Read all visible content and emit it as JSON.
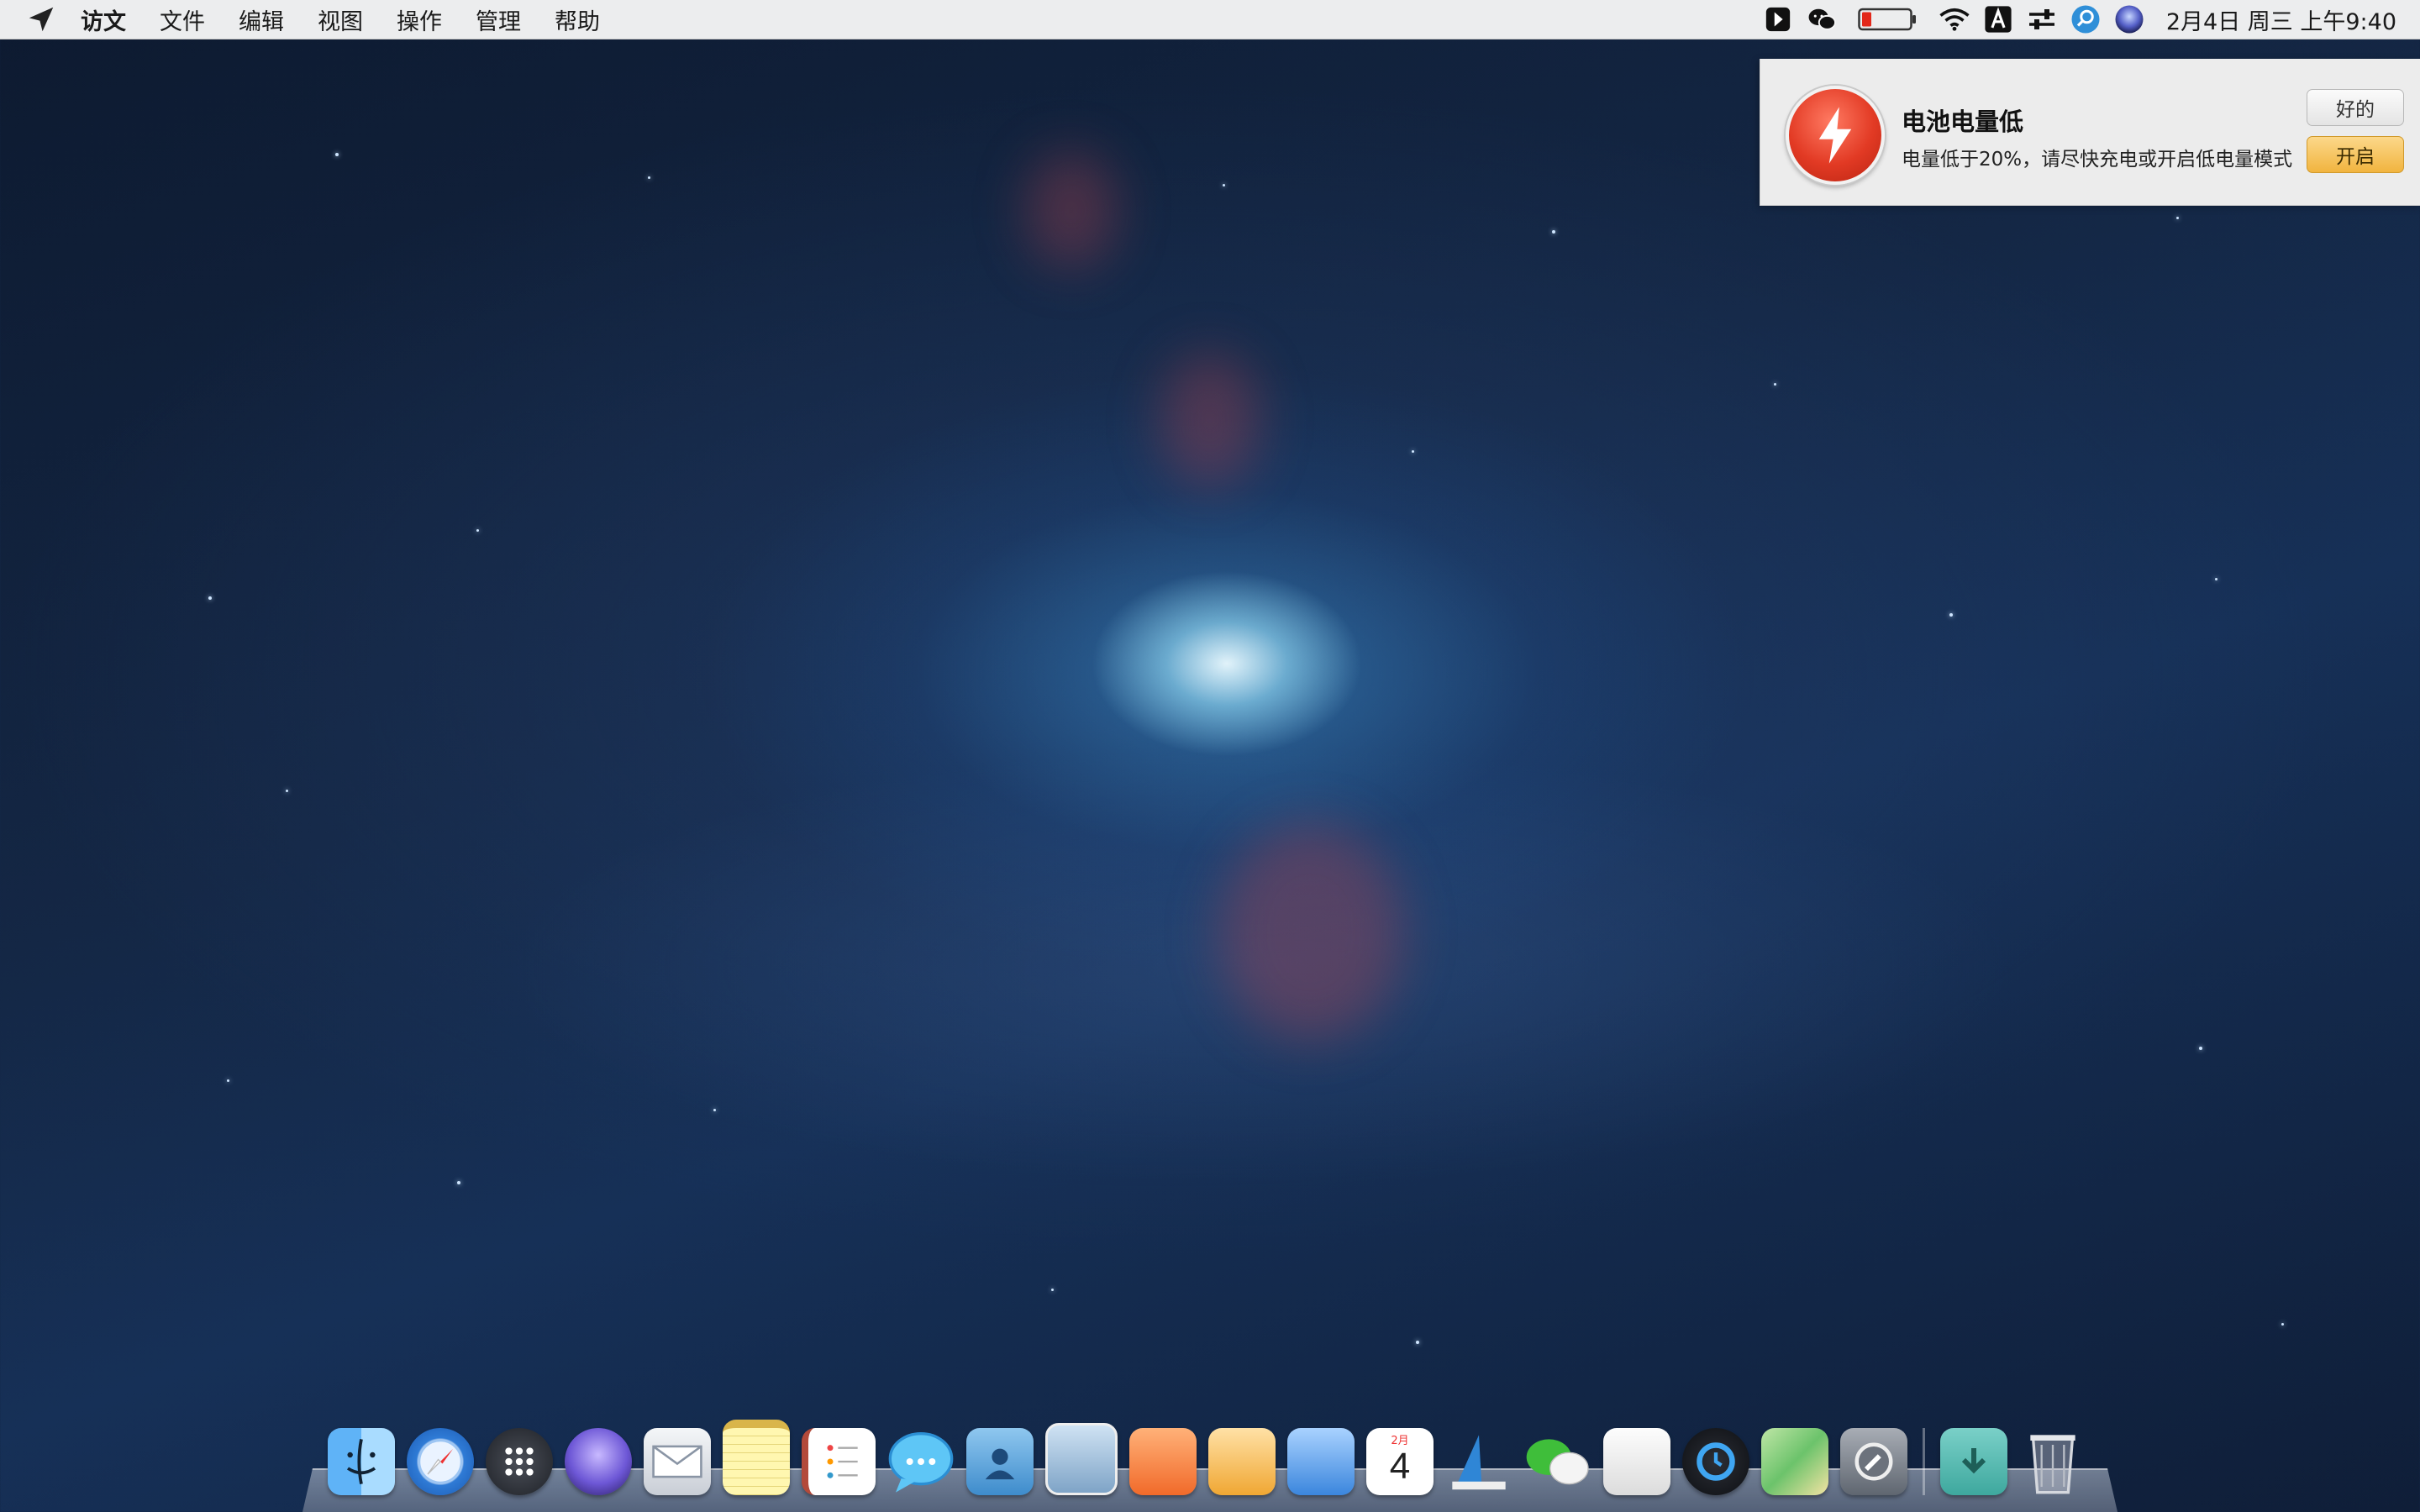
{
  "menubar": {
    "app_name": "访文",
    "menus": [
      "文件",
      "编辑",
      "视图",
      "操作",
      "管理",
      "帮助"
    ],
    "status_icons": [
      "sketch-icon",
      "wechat-icon",
      "battery-icon",
      "wifi-icon",
      "input-method-icon",
      "controls-icon",
      "spotlight-icon",
      "siri-icon"
    ],
    "battery_level": 0.2,
    "clock": "2月4日 周三 上午9:40"
  },
  "notification": {
    "title": "电池电量低",
    "body": "电量低于20%，请尽快充电或开启低电量模式",
    "ok_label": "好的",
    "enable_label": "开启"
  },
  "dock": {
    "calendar_month": "2月",
    "calendar_day": "4",
    "apps": [
      "finder",
      "safari",
      "launchpad",
      "siri",
      "mail",
      "notes",
      "reminders",
      "messages",
      "contacts",
      "preview",
      "pages",
      "keynote",
      "numbers",
      "calendar",
      "migration",
      "wechat",
      "textedit",
      "time-machine",
      "maps",
      "system-preferences"
    ],
    "right_items": [
      "downloads",
      "trash"
    ]
  }
}
